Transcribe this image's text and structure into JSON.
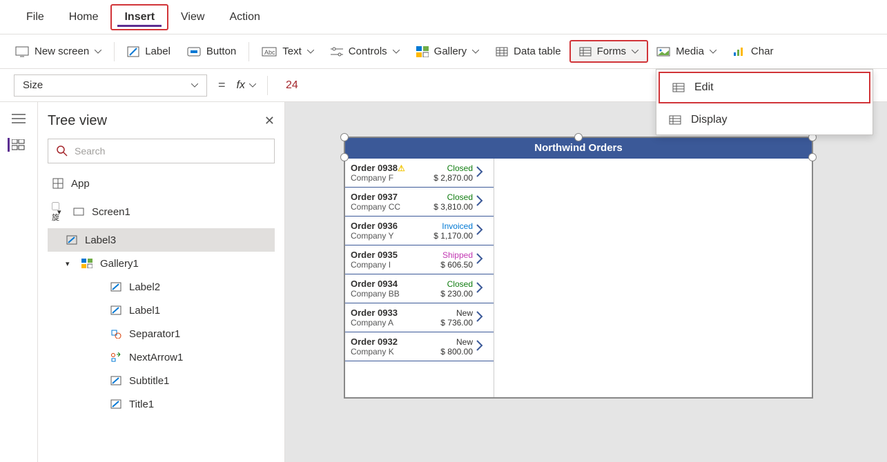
{
  "menu": {
    "file": "File",
    "home": "Home",
    "insert": "Insert",
    "view": "View",
    "action": "Action"
  },
  "ribbon": {
    "newscreen": "New screen",
    "label": "Label",
    "button": "Button",
    "text": "Text",
    "controls": "Controls",
    "gallery": "Gallery",
    "datatable": "Data table",
    "forms": "Forms",
    "media": "Media",
    "charts": "Char"
  },
  "forms_menu": {
    "edit": "Edit",
    "display": "Display"
  },
  "formula": {
    "property": "Size",
    "value": "24"
  },
  "tree": {
    "title": "Tree view",
    "search_placeholder": "Search",
    "items": {
      "app": "App",
      "screen1": "Screen1",
      "label3": "Label3",
      "gallery1": "Gallery1",
      "label2": "Label2",
      "label1": "Label1",
      "separator1": "Separator1",
      "nextarrow1": "NextArrow1",
      "subtitle1": "Subtitle1",
      "title1": "Title1"
    }
  },
  "app": {
    "title": "Northwind Orders",
    "orders": [
      {
        "no": "Order 0938",
        "warn": true,
        "status": "Closed",
        "company": "Company F",
        "amount": "$ 2,870.00"
      },
      {
        "no": "Order 0937",
        "status": "Closed",
        "company": "Company CC",
        "amount": "$ 3,810.00"
      },
      {
        "no": "Order 0936",
        "status": "Invoiced",
        "company": "Company Y",
        "amount": "$ 1,170.00"
      },
      {
        "no": "Order 0935",
        "status": "Shipped",
        "company": "Company I",
        "amount": "$ 606.50"
      },
      {
        "no": "Order 0934",
        "status": "Closed",
        "company": "Company BB",
        "amount": "$ 230.00"
      },
      {
        "no": "Order 0933",
        "status": "New",
        "company": "Company A",
        "amount": "$ 736.00"
      },
      {
        "no": "Order 0932",
        "status": "New",
        "company": "Company K",
        "amount": "$ 800.00"
      }
    ]
  }
}
